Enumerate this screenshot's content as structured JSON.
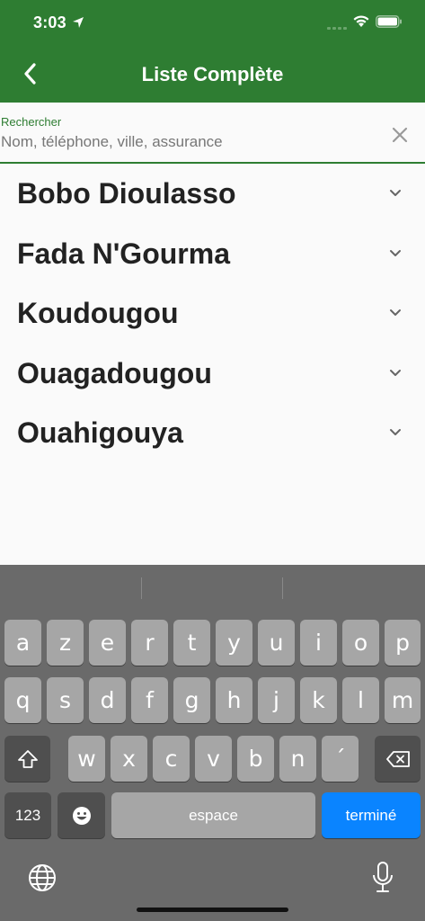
{
  "status": {
    "time": "3:03"
  },
  "nav": {
    "title": "Liste Complète"
  },
  "search": {
    "label": "Rechercher",
    "placeholder": "Nom, téléphone, ville, assurance",
    "value": ""
  },
  "cities": [
    "Bobo Dioulasso",
    "Fada N'Gourma",
    "Koudougou",
    "Ouagadougou",
    "Ouahigouya"
  ],
  "keyboard": {
    "row1": [
      "a",
      "z",
      "e",
      "r",
      "t",
      "y",
      "u",
      "i",
      "o",
      "p"
    ],
    "row2": [
      "q",
      "s",
      "d",
      "f",
      "g",
      "h",
      "j",
      "k",
      "l",
      "m"
    ],
    "row3": [
      "w",
      "x",
      "c",
      "v",
      "b",
      "n",
      "´"
    ],
    "numbers_key": "123",
    "space_key": "espace",
    "return_key": "terminé"
  },
  "colors": {
    "header": "#2e7d32",
    "accent": "#2e7d32",
    "return_key": "#0a84ff"
  },
  "icons": [
    "location-arrow-icon",
    "cellular-signal-icon",
    "wifi-icon",
    "battery-icon",
    "back-chevron-icon",
    "clear-icon",
    "chevron-down-icon",
    "shift-icon",
    "backspace-icon",
    "emoji-icon",
    "globe-icon",
    "microphone-icon"
  ]
}
